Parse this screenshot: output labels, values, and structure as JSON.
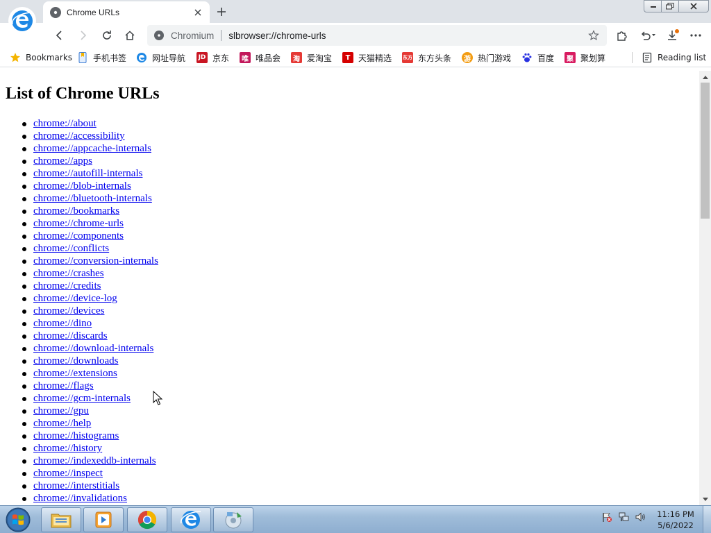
{
  "browser": {
    "tab_title": "Chrome URLs",
    "site_name": "Chromium",
    "url": "slbrowser://chrome-urls"
  },
  "bookmarks_bar": {
    "items": [
      {
        "label": "Bookmarks",
        "icon": "star-icon",
        "color": "#f4b400"
      },
      {
        "label": "手机书签",
        "icon": "phone-bookmark-icon",
        "color": "#3a7bd5"
      },
      {
        "label": "网址导航",
        "icon": "browser-logo-icon",
        "color": "#1e88e5"
      },
      {
        "label": "京东",
        "icon": "jd-icon",
        "color": "#c91623",
        "glyph": "JD"
      },
      {
        "label": "唯品会",
        "icon": "vip-icon",
        "color": "#c2185b",
        "glyph": "唯"
      },
      {
        "label": "爱淘宝",
        "icon": "taobao-icon",
        "color": "#e53935",
        "glyph": "淘"
      },
      {
        "label": "天猫精选",
        "icon": "tmall-icon",
        "color": "#d50000",
        "glyph": "T"
      },
      {
        "label": "东方头条",
        "icon": "dftt-icon",
        "color": "#e53935",
        "glyph": "东方"
      },
      {
        "label": "热门游戏",
        "icon": "game-icon",
        "color": "#f39c12",
        "glyph": "游"
      },
      {
        "label": "百度",
        "icon": "baidu-icon",
        "color": "#2932e1",
        "glyph": "百"
      },
      {
        "label": "聚划算",
        "icon": "juhuasuan-icon",
        "color": "#d81b60",
        "glyph": "聚"
      }
    ],
    "reading_list": "Reading list"
  },
  "page": {
    "title": "List of Chrome URLs",
    "urls": [
      "chrome://about",
      "chrome://accessibility",
      "chrome://appcache-internals",
      "chrome://apps",
      "chrome://autofill-internals",
      "chrome://blob-internals",
      "chrome://bluetooth-internals",
      "chrome://bookmarks",
      "chrome://chrome-urls",
      "chrome://components",
      "chrome://conflicts",
      "chrome://conversion-internals",
      "chrome://crashes",
      "chrome://credits",
      "chrome://device-log",
      "chrome://devices",
      "chrome://dino",
      "chrome://discards",
      "chrome://download-internals",
      "chrome://downloads",
      "chrome://extensions",
      "chrome://flags",
      "chrome://gcm-internals",
      "chrome://gpu",
      "chrome://help",
      "chrome://histograms",
      "chrome://history",
      "chrome://indexeddb-internals",
      "chrome://inspect",
      "chrome://interstitials",
      "chrome://invalidations"
    ]
  },
  "taskbar": {
    "time": "11:16 PM",
    "date": "5/6/2022",
    "apps": [
      "file-explorer-icon",
      "media-player-icon",
      "chrome-icon",
      "browser-logo-icon",
      "media-center-icon"
    ]
  },
  "colors": {
    "link": "#0000ee",
    "accent": "#1e88e5",
    "notification_dot": "#e8710a"
  }
}
